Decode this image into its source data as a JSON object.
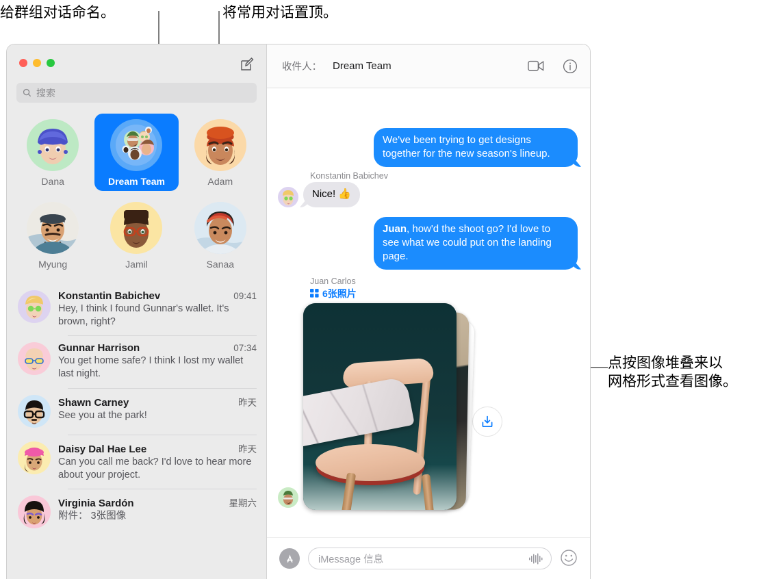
{
  "callouts": {
    "name_group": "给群组对话命名。",
    "pin_top": "将常用对话置顶。",
    "image_stack": "点按图像堆叠来以\n网格形式查看图像。"
  },
  "sidebar": {
    "search": {
      "placeholder": "搜索",
      "icon": "search-icon"
    },
    "compose_icon": "compose-icon",
    "window_controls": [
      "close",
      "minimize",
      "maximize"
    ],
    "pinned": [
      {
        "label": "Dana",
        "selected": false,
        "bg": "#bde9c4"
      },
      {
        "label": "Dream Team",
        "selected": true,
        "bg": "#5aa9f8"
      },
      {
        "label": "Adam",
        "selected": false,
        "bg": "#fbd9a8"
      },
      {
        "label": "Myung",
        "selected": false,
        "bg": "#f4f2ee"
      },
      {
        "label": "Jamil",
        "selected": false,
        "bg": "#fbe5a3"
      },
      {
        "label": "Sanaa",
        "selected": false,
        "bg": "#dfe9f2"
      }
    ],
    "conversations": [
      {
        "name": "Konstantin Babichev",
        "time": "09:41",
        "preview": "Hey, I think I found Gunnar's wallet. It's brown, right?",
        "avatar_bg": "#ddd3f0"
      },
      {
        "name": "Gunnar Harrison",
        "time": "07:34",
        "preview": "You get home safe? I think I lost my wallet last night.",
        "avatar_bg": "#f9ccd8"
      },
      {
        "name": "Shawn Carney",
        "time": "昨天",
        "preview": "See you at the park!",
        "avatar_bg": "#cfe6f7"
      },
      {
        "name": "Daisy Dal Hae Lee",
        "time": "昨天",
        "preview": "Can you call me back? I'd love to hear more about your project.",
        "avatar_bg": "#fbecb0"
      },
      {
        "name": "Virginia Sardón",
        "time": "星期六",
        "preview": "附件： 3张图像",
        "avatar_bg": "#f9c8d8"
      }
    ]
  },
  "thread": {
    "to_label": "收件人：",
    "to_value": "Dream Team",
    "facetime_icon": "video-camera-icon",
    "info_icon": "info-circle-icon",
    "messages": [
      {
        "direction": "out",
        "text": "We've been trying to get designs together for the new season's lineup."
      },
      {
        "direction": "in",
        "sender": "Konstantin Babichev",
        "text": "Nice! 👍"
      },
      {
        "direction": "out",
        "text_bold": "Juan",
        "text": ", how'd the shoot go? I'd love to see what we could put on the landing page."
      }
    ],
    "photo_attachment": {
      "sender": "Juan Carlos",
      "count_label": "6张照片",
      "grid_icon": "grid-icon",
      "download_icon": "download-icon"
    }
  },
  "composer": {
    "apps_icon": "app-store-icon",
    "placeholder": "iMessage 信息",
    "audio_icon": "audio-waveform-icon",
    "emoji_icon": "emoji-smiley-icon"
  },
  "colors": {
    "accent_blue": "#0a7cff",
    "bubble_out": "#1b8cfe",
    "bubble_in": "#e6e5ea",
    "sidebar_bg": "#ebebeb"
  }
}
